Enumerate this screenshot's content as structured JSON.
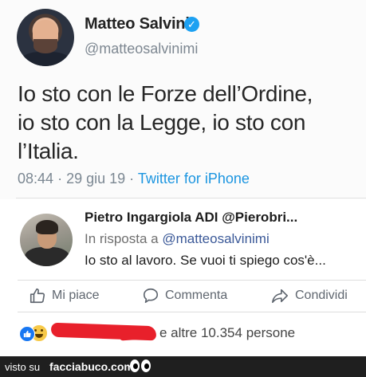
{
  "tweet": {
    "author_name": "Matteo Salvini",
    "verified_mark": "✓",
    "handle": "@matteosalvinimi",
    "text_lines": [
      "Io sto con le Forze dell’Ordine,",
      "io sto con la Legge, io sto con",
      "l’Italia."
    ],
    "time": "08:44",
    "date": "29 giu 19",
    "separator": "·",
    "source": "Twitter for iPhone",
    "source_color": "#1b95e0"
  },
  "comment": {
    "author": "Pietro Ingargiola ADI @Pierobri...",
    "reply_prefix": "In risposta a",
    "reply_mention": "@matteosalvinimi",
    "text": "Io sto al lavoro. Se vuoi ti spiego cos'è..."
  },
  "actions": {
    "like_label": "Mi piace",
    "comment_label": "Commenta",
    "share_label": "Condividi",
    "icons": [
      "thumbs-up-icon",
      "speech-bubble-icon",
      "share-arrow-icon"
    ]
  },
  "reactions": {
    "icons": [
      "like-reaction-icon",
      "haha-reaction-icon"
    ],
    "others_text": "e altre 10.354 persone",
    "redaction_color": "#e8202b"
  },
  "footer": {
    "visto_label": "visto su",
    "site": "facciabuco.com"
  }
}
